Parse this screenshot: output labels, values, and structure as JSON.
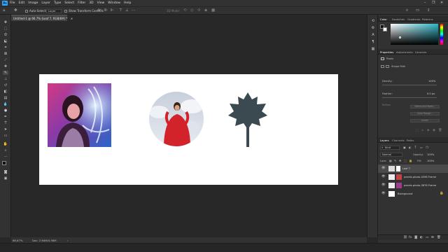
{
  "menubar": {
    "logo": "Ps",
    "items": [
      "File",
      "Edit",
      "Image",
      "Layer",
      "Type",
      "Select",
      "Filter",
      "3D",
      "View",
      "Window",
      "Help"
    ],
    "window_controls": [
      "–",
      "❐",
      "✕"
    ]
  },
  "options": {
    "auto_select_label": "Auto-Select:",
    "auto_select_value": "Layer",
    "show_transform_label": "Show Transform Controls",
    "mode_3d_label": "3D Mode:"
  },
  "document": {
    "tab_title": "Untitled-1 @ 66.7% (Leaf 7, RGB/8#) *",
    "tab_close": "×"
  },
  "status": {
    "zoom": "66.67%",
    "doc_size": "Doc: 2.64M/4.56M"
  },
  "panels": {
    "color_tabs": [
      "Color",
      "Swatches",
      "Gradients",
      "Patterns"
    ],
    "properties_tabs": [
      "Properties",
      "Adjustments",
      "Libraries"
    ],
    "properties_kind": "Pixels",
    "shape_path": "Shape Path",
    "density_label": "Density:",
    "density_value": "100%",
    "feather_label": "Feather:",
    "feather_value": "0.0 px",
    "refine_label": "Refine:",
    "refine_buttons": [
      "Select and Mask...",
      "Color Range...",
      "Invert"
    ],
    "layers_tabs": [
      "Layers",
      "Channels",
      "Paths"
    ],
    "kind_label": "Kind",
    "blend_mode": "Normal",
    "opacity_label": "Opacity:",
    "opacity_value": "100%",
    "lock_label": "Lock:",
    "fill_label": "Fill:",
    "fill_value": "100%",
    "layers": [
      {
        "name": "Leaf 7",
        "selected": true,
        "thumb": "#dcdcdc"
      },
      {
        "name": "pexels-photo-4596 Frame",
        "selected": false,
        "thumb": "#c94040"
      },
      {
        "name": "pexels-photo-3876 Frame",
        "selected": false,
        "thumb": "#9b3c8c"
      },
      {
        "name": "Background",
        "selected": false,
        "thumb": "#ffffff"
      }
    ]
  },
  "colors": {
    "foreground": "#111111",
    "background": "#ffffff",
    "leaf": "#3a4a50",
    "picker_hue": "#2fb7c9"
  }
}
